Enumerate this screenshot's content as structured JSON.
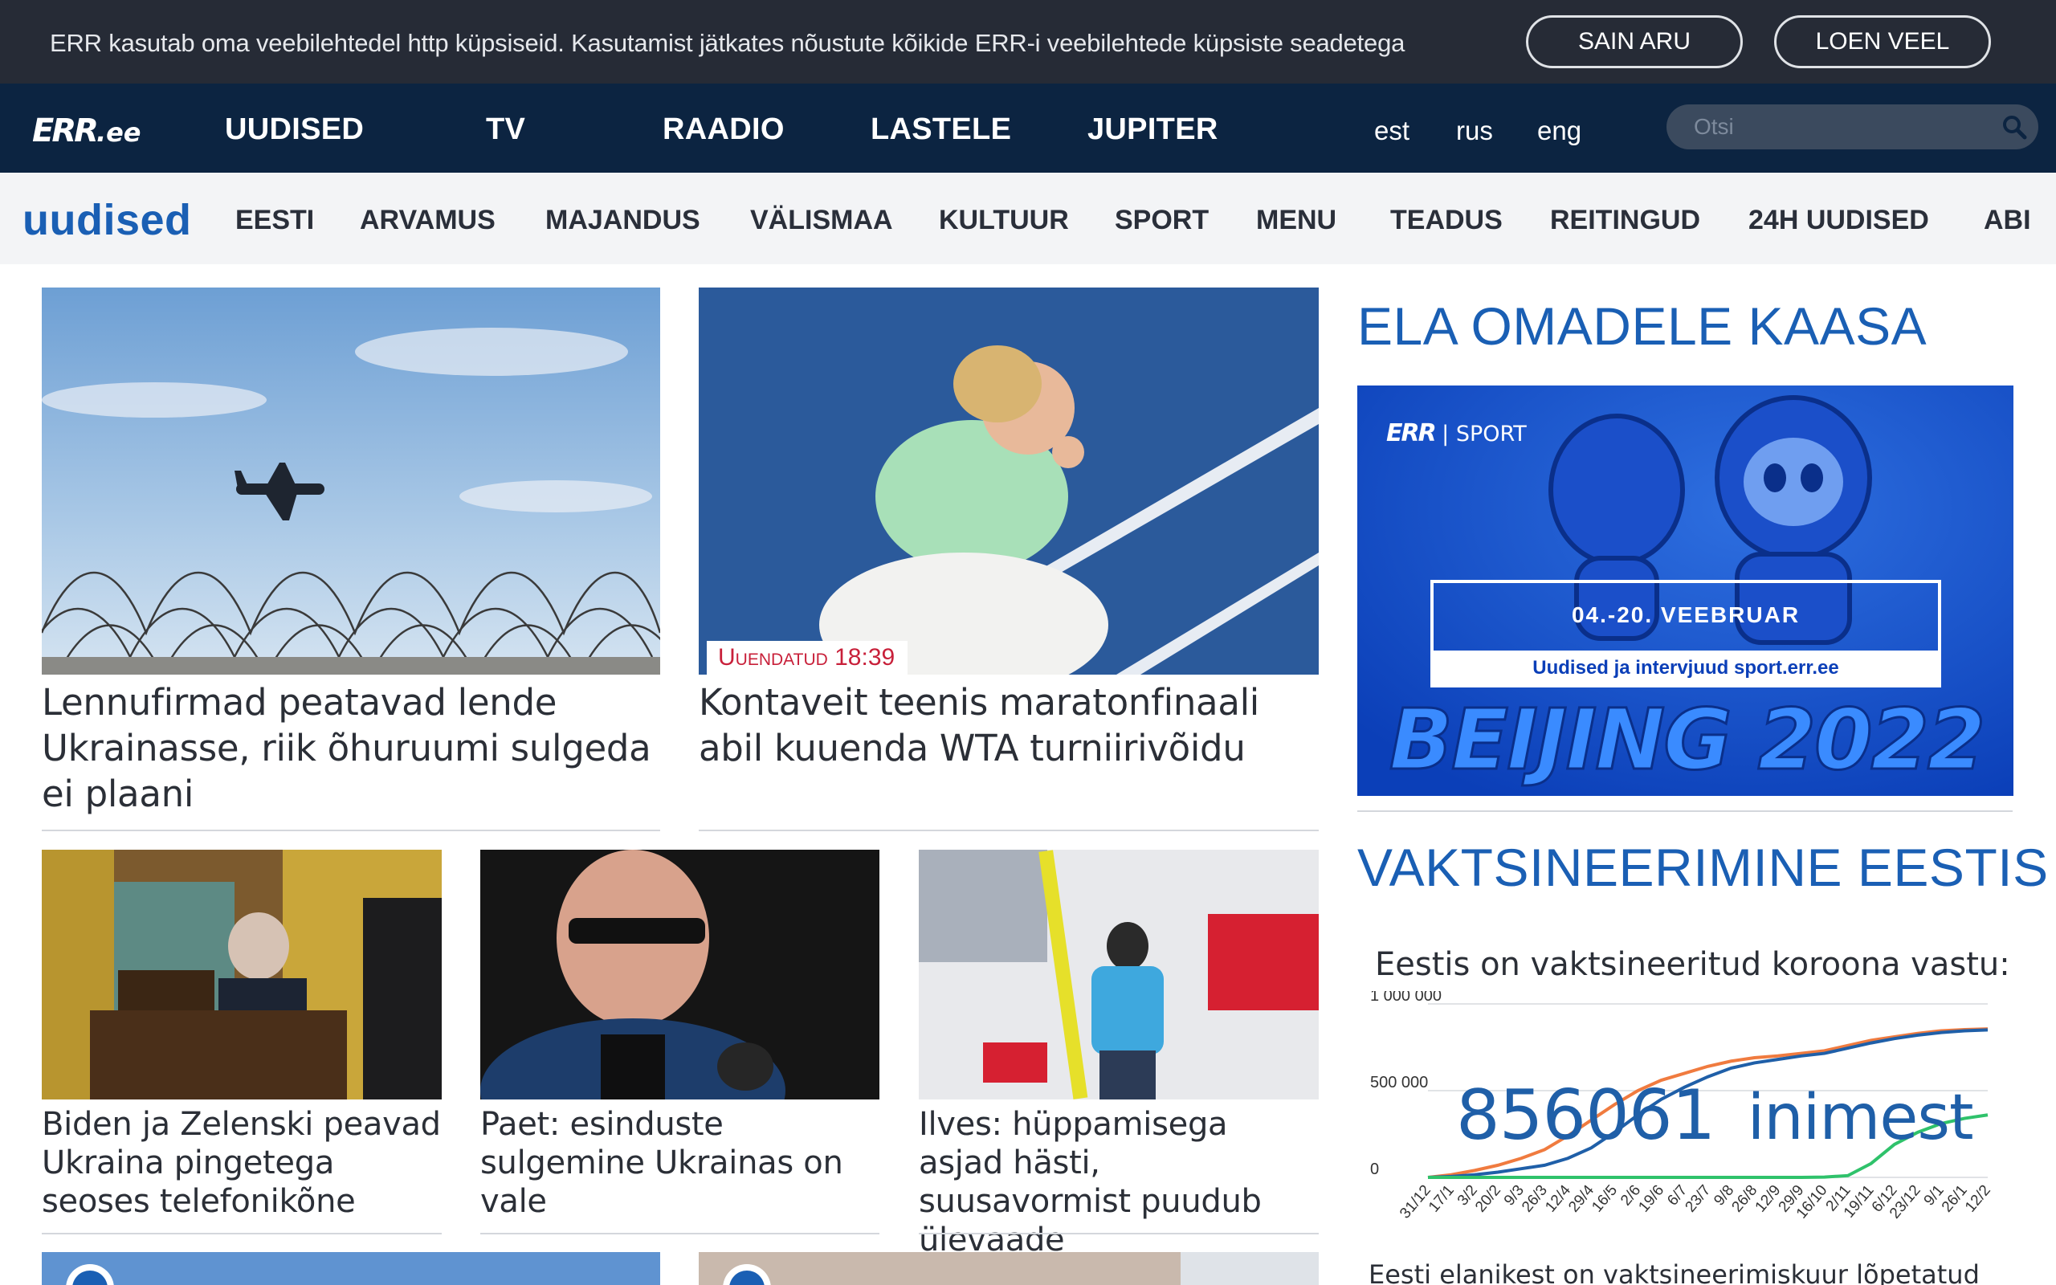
{
  "cookie": {
    "text": "ERR kasutab oma veebilehtedel http küpsiseid. Kasutamist jätkates nõustute kõikide ERR-i veebilehtede küpsiste seadetega",
    "accept_label": "SAIN ARU",
    "more_label": "LOEN VEEL"
  },
  "header": {
    "logo_mark": "ERR",
    "logo_suffix": ".ee",
    "nav": [
      "UUDISED",
      "TV",
      "RAADIO",
      "LASTELE",
      "JUPITER"
    ],
    "languages": [
      "est",
      "rus",
      "eng"
    ],
    "search_placeholder": "Otsi"
  },
  "subnav": {
    "section_title": "uudised",
    "items": [
      "EESTI",
      "ARVAMUS",
      "MAJANDUS",
      "VÄLISMAA",
      "KULTUUR",
      "SPORT",
      "MENU",
      "TEADUS",
      "REITINGUD",
      "24H UUDISED",
      "ABI"
    ]
  },
  "articles": [
    {
      "title": "Lennufirmad peatavad lende Ukrainasse, riik õhuruumi sulgeda ei plaani"
    },
    {
      "title": "Kontaveit teenis maratonfinaali abil kuuenda WTA turniirivõidu",
      "badge": "Uuendatud 18:39"
    },
    {
      "title": "Biden ja Zelenski peavad Ukraina pingetega seoses telefonikõne"
    },
    {
      "title": "Paet: esinduste sulgemine Ukrainas on vale"
    },
    {
      "title": "Ilves: hüppamisega asjad hästi, suusavormist puudub ülevaade"
    }
  ],
  "sidebar": {
    "promo_heading": "ELA OMADELE KAASA",
    "promo": {
      "brand": "ERR",
      "brand_section": "SPORT",
      "dates": "04.-20. VEEBRUAR",
      "subline": "Uudised ja intervjuud sport.err.ee",
      "event": "BEIJING 2022"
    },
    "vax_heading": "VAKTSINEERIMINE EESTIS",
    "vax_intro": "Eestis on vaktsineeritud koroona vastu:",
    "vax_count": "856061",
    "vax_unit": "inimest",
    "vax_footer": "Eesti elanikest on vaktsineerimiskuur lõpetatud"
  },
  "colors": {
    "cookie_bg": "#262b36",
    "nav_bg": "#0c2441",
    "accent_blue": "#1a5fb4",
    "badge_red": "#c8203a",
    "series_orange": "#f07b3f",
    "series_blue": "#1f5fa8",
    "series_green": "#2fc26b"
  },
  "chart_data": {
    "type": "line",
    "title": "",
    "ylabel": "",
    "ylim": [
      0,
      1000000
    ],
    "yticks": [
      "1 000 000",
      "500 000",
      "0"
    ],
    "x": [
      "31/12",
      "17/1",
      "3/2",
      "20/2",
      "9/3",
      "26/3",
      "12/4",
      "29/4",
      "16/5",
      "2/6",
      "19/6",
      "6/7",
      "23/7",
      "9/8",
      "26/8",
      "12/9",
      "29/9",
      "16/10",
      "2/11",
      "19/11",
      "6/12",
      "23/12",
      "9/1",
      "26/1",
      "12/2"
    ],
    "series": [
      {
        "values": [
          0,
          15000,
          40000,
          70000,
          110000,
          160000,
          240000,
          330000,
          420000,
          500000,
          560000,
          600000,
          640000,
          670000,
          690000,
          700000,
          715000,
          730000,
          760000,
          790000,
          810000,
          830000,
          845000,
          852000,
          856061
        ]
      },
      {
        "values": [
          0,
          5000,
          15000,
          30000,
          50000,
          70000,
          110000,
          170000,
          260000,
          360000,
          450000,
          520000,
          580000,
          630000,
          660000,
          680000,
          700000,
          715000,
          745000,
          775000,
          800000,
          820000,
          835000,
          845000,
          850000
        ]
      },
      {
        "values": [
          0,
          0,
          0,
          0,
          0,
          0,
          0,
          0,
          0,
          0,
          0,
          0,
          0,
          0,
          0,
          0,
          0,
          2000,
          10000,
          80000,
          190000,
          260000,
          310000,
          340000,
          360000
        ]
      }
    ]
  }
}
